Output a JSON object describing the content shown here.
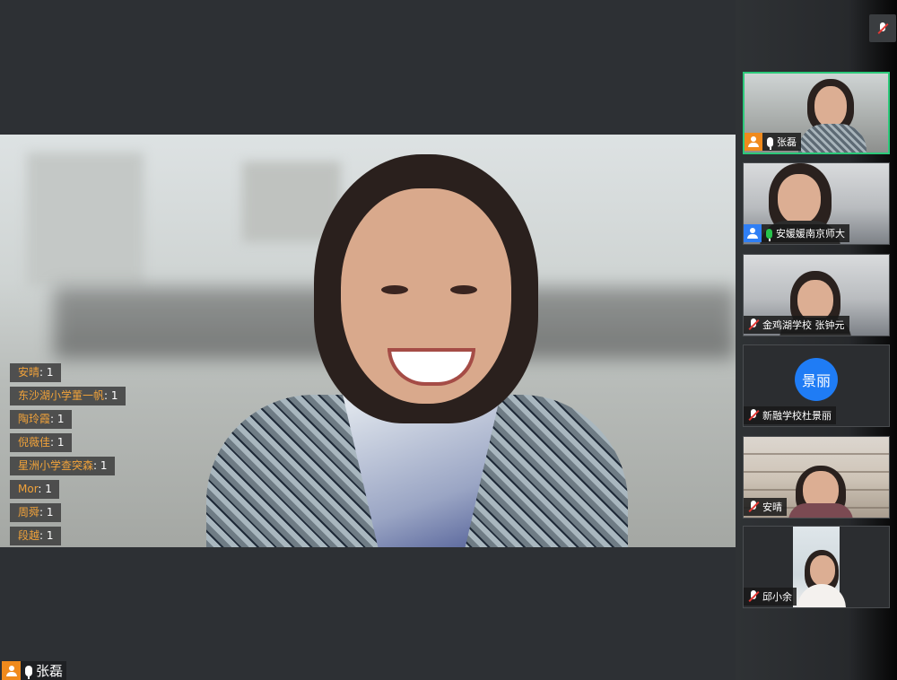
{
  "chat_messages": [
    {
      "name": "安晴",
      "count": ": 1"
    },
    {
      "name": "东沙湖小学董一帆",
      "count": ": 1"
    },
    {
      "name": "陶玲霞",
      "count": ": 1"
    },
    {
      "name": "倪薇佳",
      "count": ": 1"
    },
    {
      "name": "星洲小学查突森",
      "count": ": 1"
    },
    {
      "name": "Mor",
      "count": ": 1"
    },
    {
      "name": "周舜",
      "count": ": 1"
    },
    {
      "name": "段越",
      "count": ": 1"
    }
  ],
  "main_speaker": {
    "name": "张磊"
  },
  "participants": [
    {
      "name": "张磊",
      "avatar": "person-icon",
      "avatar_color": "#f08a1c",
      "mic": "on",
      "active": true
    },
    {
      "name": "安媛媛南京师大",
      "avatar": "person-icon",
      "avatar_color": "#2f7ff5",
      "mic": "speaking",
      "active": false
    },
    {
      "name": "金鸡湖学校 张钟元",
      "mic": "muted",
      "active": false
    },
    {
      "name": "新融学校杜景丽",
      "mic": "muted",
      "active": false,
      "avatar_text": "景丽",
      "avatar_text_color": "#1f7cf5"
    },
    {
      "name": "安晴",
      "mic": "muted",
      "active": false
    },
    {
      "name": "邱小余",
      "mic": "muted",
      "active": false
    }
  ],
  "colors": {
    "chat_name": "#f0a23a",
    "active_border": "#2cc97a",
    "muted_slash": "#e53935",
    "speaking_mic": "#27c24c"
  }
}
